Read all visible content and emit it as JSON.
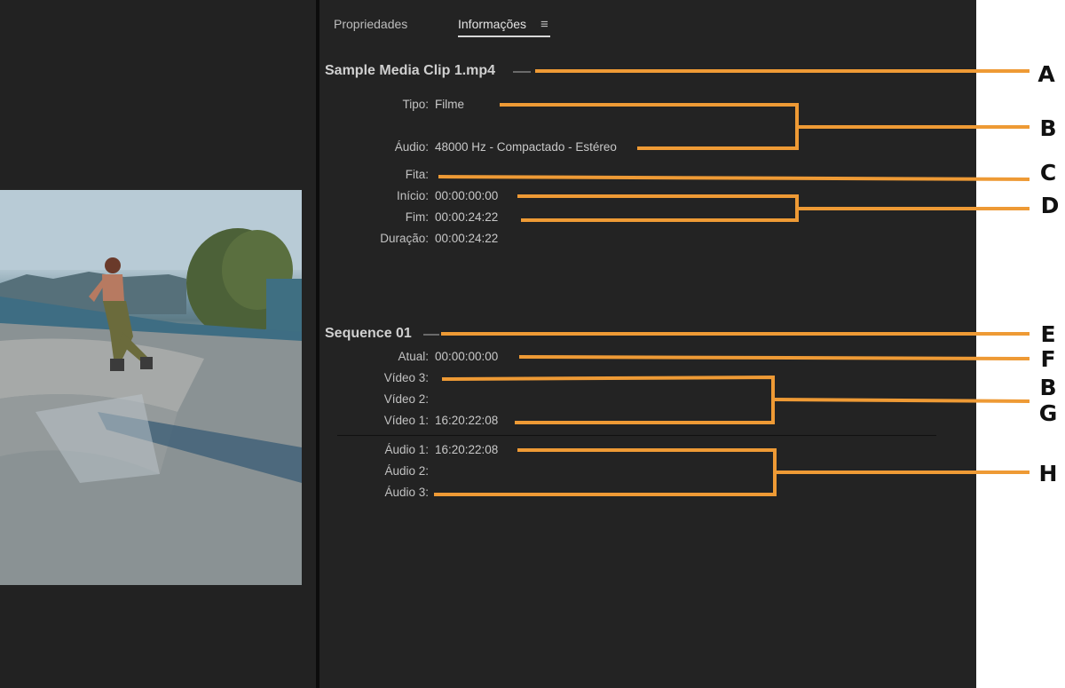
{
  "tabs": {
    "properties": "Propriedades",
    "info": "Informações"
  },
  "icons": {
    "menu": "hamburger-menu-icon",
    "menu_glyph": "≡"
  },
  "clip": {
    "name": "Sample Media Clip 1.mp4",
    "rows": [
      {
        "label": "Tipo:",
        "value": "Filme"
      },
      {
        "label": "Áudio:",
        "value": "48000 Hz - Compactado - Estéreo"
      },
      {
        "label": "Fita:",
        "value": ""
      },
      {
        "label": "Início:",
        "value": "00:00:00:00"
      },
      {
        "label": "Fim:",
        "value": "00:00:24:22"
      },
      {
        "label": "Duração:",
        "value": "00:00:24:22"
      }
    ]
  },
  "sequence": {
    "name": "Sequence 01",
    "current": {
      "label": "Atual:",
      "value": "00:00:00:00"
    },
    "video": [
      {
        "label": "Vídeo 3:",
        "value": ""
      },
      {
        "label": "Vídeo 2:",
        "value": ""
      },
      {
        "label": "Vídeo 1:",
        "value": "16:20:22:08"
      }
    ],
    "audio": [
      {
        "label": "Áudio 1:",
        "value": "16:20:22:08"
      },
      {
        "label": "Áudio 2:",
        "value": ""
      },
      {
        "label": "Áudio 3:",
        "value": ""
      }
    ]
  },
  "callouts": [
    "A",
    "B",
    "C",
    "D",
    "E",
    "F",
    "B",
    "G",
    "H"
  ],
  "colors": {
    "callout_line": "#ee9a35",
    "panel_bg": "#232323",
    "text": "#c8c8c8"
  }
}
